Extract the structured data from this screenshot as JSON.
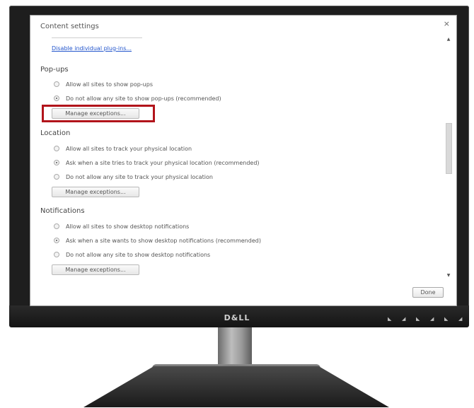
{
  "monitor": {
    "brand": "D&LL"
  },
  "dialog": {
    "title": "Content settings",
    "close_icon": "close-icon",
    "plugins_link": "Disable individual plug-ins...",
    "done_label": "Done"
  },
  "popups": {
    "heading": "Pop-ups",
    "options": [
      {
        "label": "Allow all sites to show pop-ups",
        "selected": false
      },
      {
        "label": "Do not allow any site to show pop-ups (recommended)",
        "selected": true
      }
    ],
    "button": "Manage exceptions..."
  },
  "location": {
    "heading": "Location",
    "options": [
      {
        "label": "Allow all sites to track your physical location",
        "selected": false
      },
      {
        "label": "Ask when a site tries to track your physical location (recommended)",
        "selected": true
      },
      {
        "label": "Do not allow any site to track your physical location",
        "selected": false
      }
    ],
    "button": "Manage exceptions..."
  },
  "notifications": {
    "heading": "Notifications",
    "options": [
      {
        "label": "Allow all sites to show desktop notifications",
        "selected": false
      },
      {
        "label": "Ask when a site wants to show desktop notifications (recommended)",
        "selected": true
      },
      {
        "label": "Do not allow any site to show desktop notifications",
        "selected": false
      }
    ],
    "button": "Manage exceptions..."
  },
  "highlight_color": "#b2141b"
}
